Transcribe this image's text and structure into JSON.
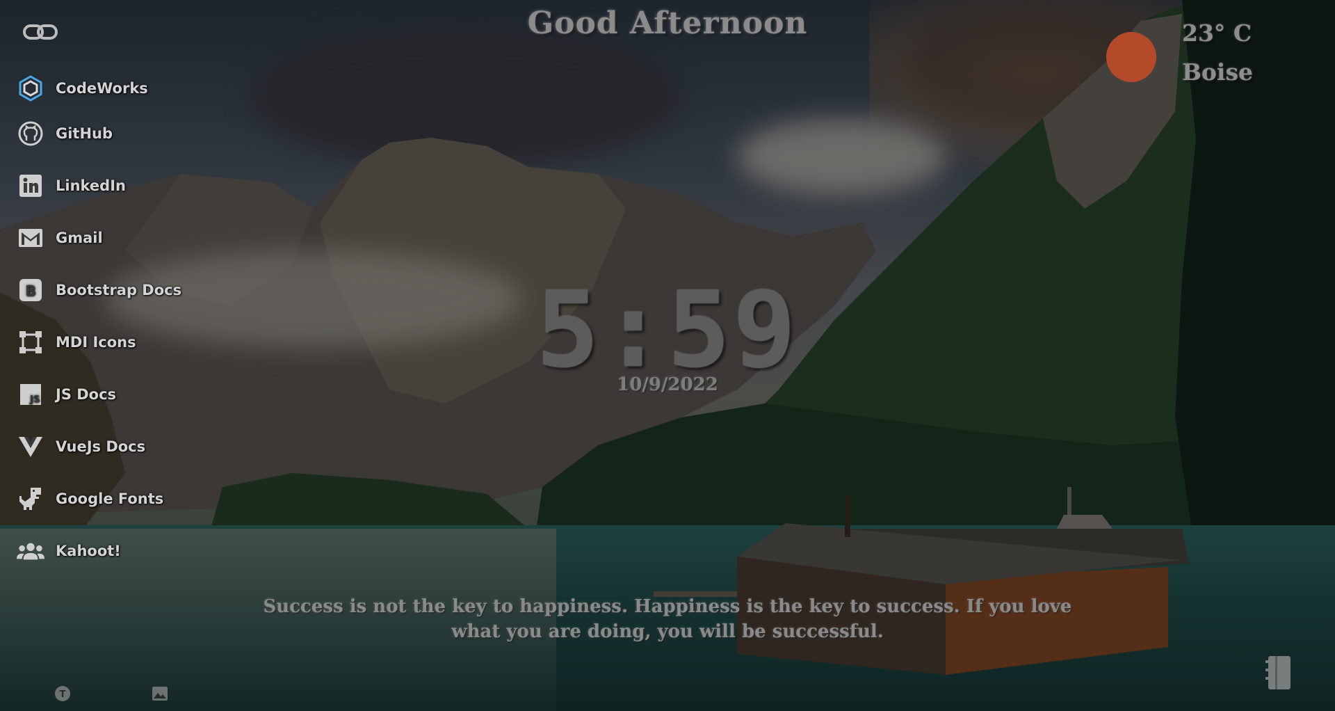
{
  "greeting": "Good Afternoon",
  "weather": {
    "temperature": "23° C",
    "city": "Boise",
    "icon": "sun-icon",
    "sun_color": "#b54a2b"
  },
  "clock": {
    "time": "5:59",
    "date": "10/9/2022"
  },
  "quote": {
    "text": "Success is not the key to happiness. Happiness is the key to success. If you love what you are doing, you will be successful."
  },
  "links": [
    {
      "label": "CodeWorks",
      "icon": "codeworks-icon"
    },
    {
      "label": "GitHub",
      "icon": "github-icon"
    },
    {
      "label": "LinkedIn",
      "icon": "linkedin-icon"
    },
    {
      "label": "Gmail",
      "icon": "gmail-icon"
    },
    {
      "label": "Bootstrap Docs",
      "icon": "bootstrap-icon"
    },
    {
      "label": "MDI Icons",
      "icon": "mdi-icon"
    },
    {
      "label": "JS Docs",
      "icon": "javascript-icon"
    },
    {
      "label": "VueJs Docs",
      "icon": "vue-icon"
    },
    {
      "label": "Google Fonts",
      "icon": "dinosaur-icon"
    },
    {
      "label": "Kahoot!",
      "icon": "account-group-icon"
    }
  ],
  "controls": {
    "links_toggle_icon": "link-icon",
    "font_toggle_icon": "font-icon",
    "background_toggle_icon": "image-icon",
    "notes_icon": "notebook-icon"
  },
  "colors": {
    "text_primary": "#d4d4d4",
    "text_muted": "#8b8b8b",
    "overlay": "rgba(0,0,0,0.38)"
  }
}
